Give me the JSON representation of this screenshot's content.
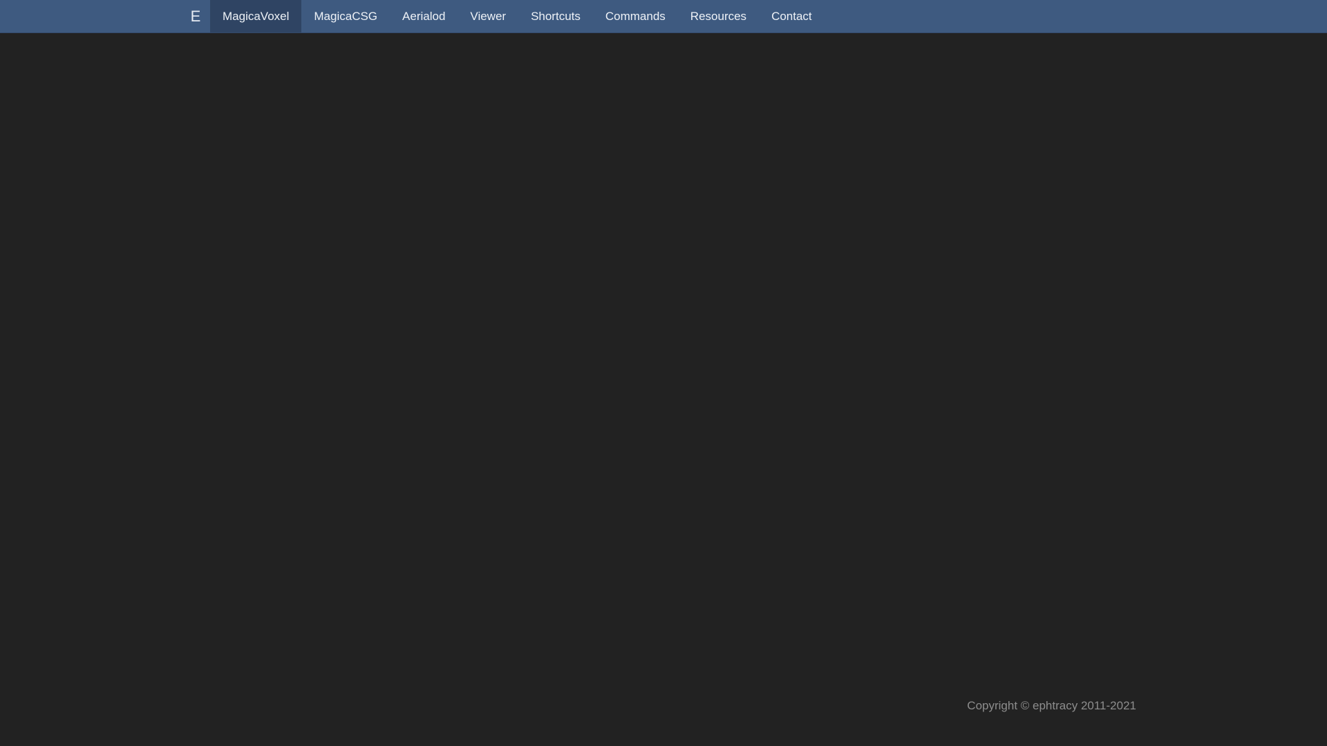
{
  "navbar": {
    "brand": "E",
    "items": [
      {
        "label": "MagicaVoxel",
        "active": true
      },
      {
        "label": "MagicaCSG",
        "active": false
      },
      {
        "label": "Aerialod",
        "active": false
      },
      {
        "label": "Viewer",
        "active": false
      },
      {
        "label": "Shortcuts",
        "active": false
      },
      {
        "label": "Commands",
        "active": false
      },
      {
        "label": "Resources",
        "active": false
      },
      {
        "label": "Contact",
        "active": false
      }
    ]
  },
  "footer": {
    "copyright": "Copyright © ephtracy 2011-2021"
  },
  "colors": {
    "navbar_bg": "#3e5a80",
    "navbar_active_bg": "#2f4463",
    "page_bg": "#222222",
    "footer_text": "#8d8d8d"
  }
}
